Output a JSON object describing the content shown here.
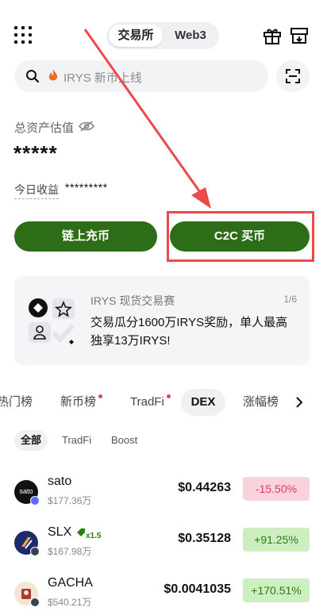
{
  "header": {
    "segments": [
      {
        "label": "交易所",
        "active": true
      },
      {
        "label": "Web3",
        "active": false
      }
    ],
    "icons": [
      "grid-menu-icon",
      "gift-icon",
      "store-icon"
    ]
  },
  "search": {
    "fire_icon": "fire-icon",
    "placeholder": "IRYS 新币上线"
  },
  "assets": {
    "label": "总资产估值",
    "value": "*****",
    "pnl_label": "今日收益",
    "pnl_value": "*********"
  },
  "actions": {
    "deposit_label": "链上充币",
    "c2c_label": "C2C 买币"
  },
  "annotation": {
    "color": "#ec4a4a"
  },
  "banner": {
    "title": "IRYS 现货交易赛",
    "page": "1/6",
    "description": "交易瓜分1600万IRYS奖励，单人最高独享13万IRYS!"
  },
  "tabs": [
    {
      "label": "热门榜",
      "dot": false,
      "active": false
    },
    {
      "label": "新币榜",
      "dot": true,
      "active": false
    },
    {
      "label": "TradFi",
      "dot": true,
      "active": false
    },
    {
      "label": "DEX",
      "dot": false,
      "active": true
    },
    {
      "label": "涨幅榜",
      "dot": false,
      "active": false
    }
  ],
  "subtabs": [
    {
      "label": "全部",
      "active": true
    },
    {
      "label": "TradFi",
      "active": false
    },
    {
      "label": "Boost",
      "active": false
    }
  ],
  "markets": [
    {
      "symbol": "sato",
      "volume": "$177.36万",
      "price": "$0.44263",
      "change": "-15.50%",
      "direction": "down",
      "coin_text": "sato",
      "coin_color": "#111111",
      "chain_color": "#5b6bff",
      "leverage": ""
    },
    {
      "symbol": "SLX",
      "volume": "$167.98万",
      "price": "$0.35128",
      "change": "+91.25%",
      "direction": "up",
      "coin_text": "",
      "coin_color": "#1d2a6b",
      "chain_color": "#334455",
      "leverage": "x1.5"
    },
    {
      "symbol": "GACHA",
      "volume": "$540.21万",
      "price": "$0.0041035",
      "change": "+170.51%",
      "direction": "up",
      "coin_text": "",
      "coin_color": "#f3e6d8",
      "chain_color": "#334455",
      "leverage": ""
    }
  ],
  "colors": {
    "primary_button": "#2d6d17",
    "up": "#2b7d12",
    "down": "#d93c5a"
  }
}
